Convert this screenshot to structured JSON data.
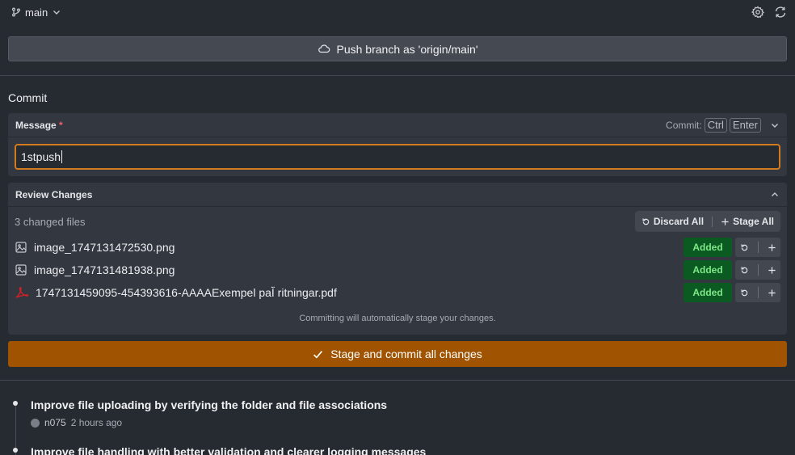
{
  "topbar": {
    "branch": "main",
    "icons": [
      "git-branch-icon",
      "chevron-down-icon",
      "gear-icon",
      "refresh-icon"
    ]
  },
  "push_button": {
    "label": "Push branch as 'origin/main'",
    "icon": "cloud-icon"
  },
  "commit": {
    "title": "Commit",
    "message_label": "Message",
    "required_mark": "*",
    "shortcut_label": "Commit:",
    "shortcut_keys": [
      "Ctrl",
      "Enter"
    ],
    "message_value": "1stpush"
  },
  "review": {
    "title": "Review Changes",
    "changed_count": "3 changed files",
    "discard_all": "Discard All",
    "stage_all": "Stage All",
    "files": [
      {
        "name": "image_1747131472530.png",
        "status": "Added",
        "icon": "image-file-icon"
      },
      {
        "name": "image_1747131481938.png",
        "status": "Added",
        "icon": "image-file-icon"
      },
      {
        "name": "1747131459095-454393616-AAAAExempel paÌ̈ ritningar.pdf",
        "status": "Added",
        "icon": "pdf-file-icon"
      }
    ],
    "note": "Committing will automatically stage your changes."
  },
  "commit_button": {
    "label": "Stage and commit all changes"
  },
  "history": [
    {
      "title": "Improve file uploading by verifying the folder and file associations",
      "author": "n075",
      "time": "2 hours ago"
    },
    {
      "title": "Improve file handling with better validation and clearer logging messages"
    }
  ],
  "colors": {
    "background": "#262a31",
    "panel": "#33373f",
    "accent_orange": "#a05300",
    "input_focus": "#d27a1e",
    "added_bg": "#0b5a22",
    "added_text": "#7ee787"
  }
}
